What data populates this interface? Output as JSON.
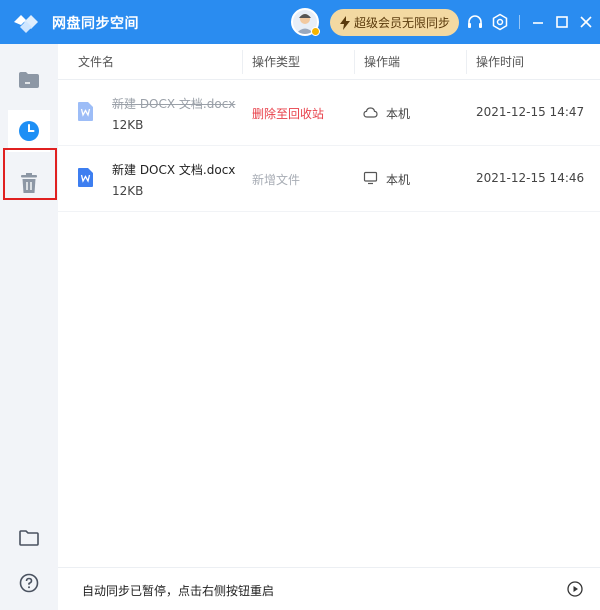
{
  "titlebar": {
    "app_title": "网盘同步空间",
    "vip_label": "超级会员无限同步",
    "icons": [
      "logo-icon",
      "avatar",
      "headset-icon",
      "settings-icon",
      "minimize-icon",
      "maximize-icon",
      "close-icon"
    ],
    "accent_color": "#2a8cf0"
  },
  "sidebar": {
    "items": [
      {
        "name": "folder-icon",
        "active": false
      },
      {
        "name": "clock-icon",
        "active": true
      },
      {
        "name": "trash-icon",
        "active": false
      }
    ],
    "bottom": [
      {
        "name": "open-folder-icon"
      },
      {
        "name": "help-icon"
      }
    ]
  },
  "table": {
    "headers": {
      "name": "文件名",
      "op_type": "操作类型",
      "device": "操作端",
      "time": "操作时间"
    },
    "rows": [
      {
        "file_name": "新建 DOCX 文档.docx",
        "size": "12KB",
        "op_type": "删除至回收站",
        "device": "本机",
        "device_icon": "cloud-icon",
        "time": "2021-12-15 14:47",
        "deleted": true
      },
      {
        "file_name": "新建 DOCX 文档.docx",
        "size": "12KB",
        "op_type": "新增文件",
        "device": "本机",
        "device_icon": "monitor-icon",
        "time": "2021-12-15 14:46",
        "deleted": false
      }
    ]
  },
  "status": {
    "text": "自动同步已暂停，点击右侧按钮重启"
  }
}
